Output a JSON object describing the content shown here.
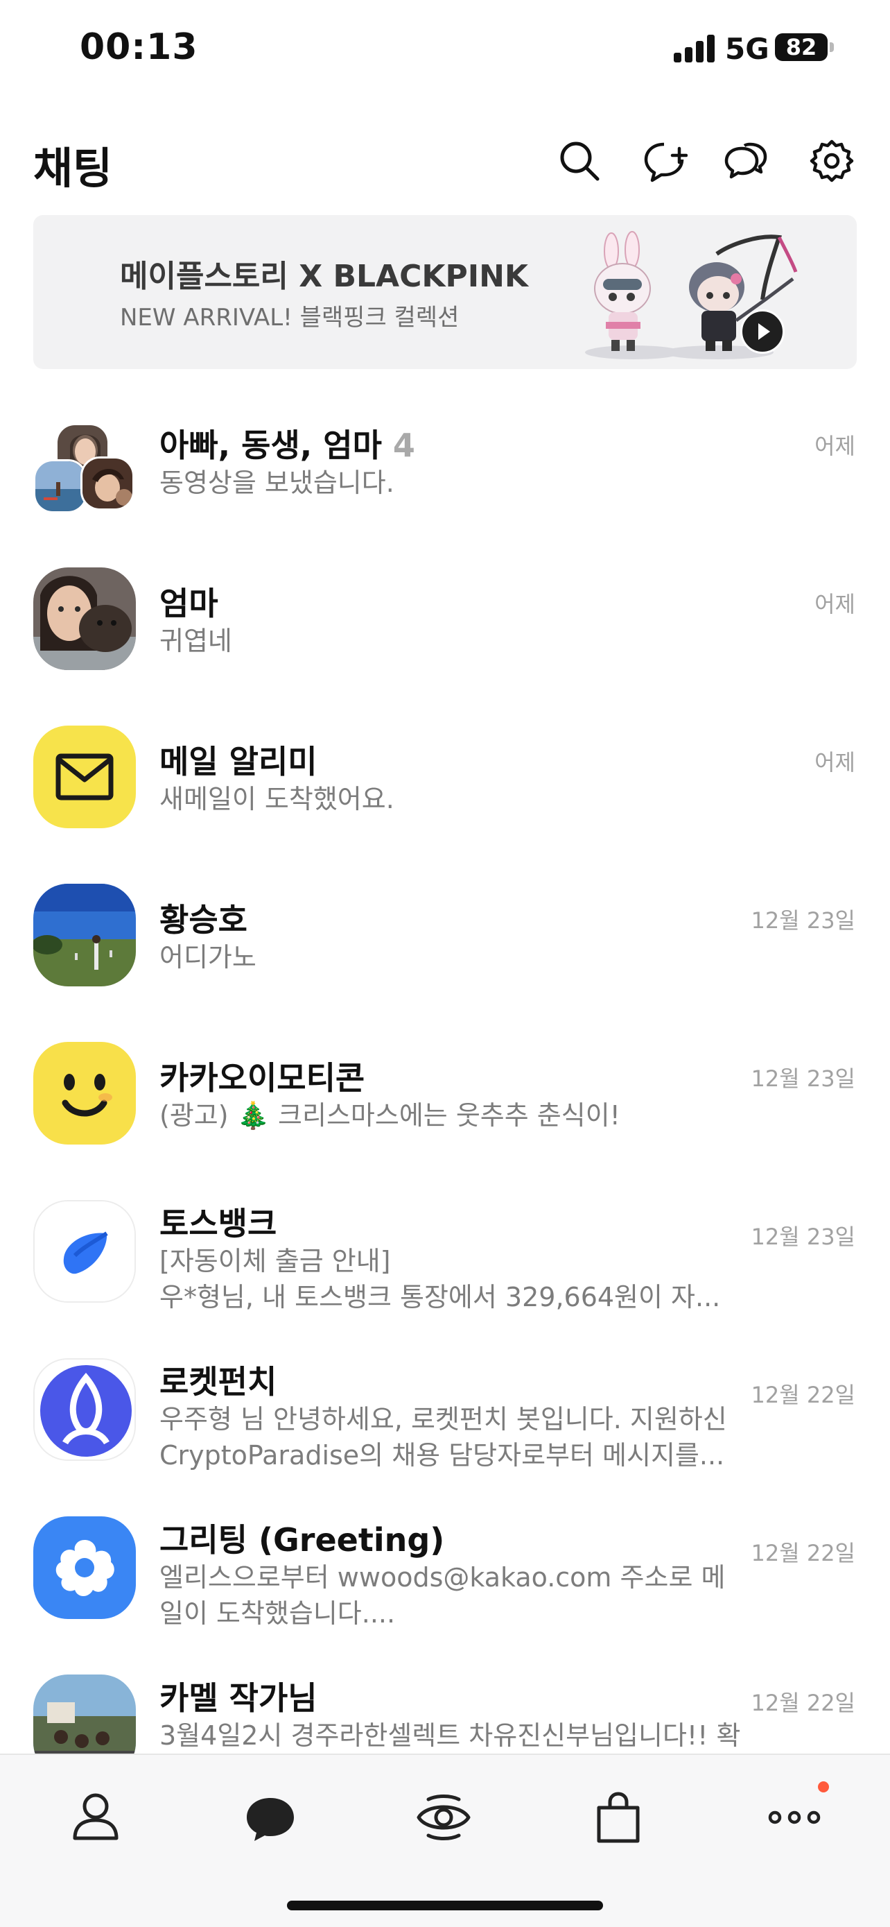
{
  "status_bar": {
    "time": "00:13",
    "network": "5G",
    "battery": "82"
  },
  "header": {
    "title": "채팅"
  },
  "banner": {
    "title": "메이플스토리 X BLACKPINK",
    "subtitle": "NEW ARRIVAL! 블랙핑크 컬렉션"
  },
  "chats": [
    {
      "name": "아빠, 동생, 엄마",
      "member_count": "4",
      "preview": "동영상을 보냈습니다.",
      "time": "어제"
    },
    {
      "name": "엄마",
      "preview": "귀엽네",
      "time": "어제"
    },
    {
      "name": "메일 알리미",
      "preview": "새메일이 도착했어요.",
      "time": "어제"
    },
    {
      "name": "황승호",
      "preview": "어디가노",
      "time": "12월 23일"
    },
    {
      "name": "카카오이모티콘",
      "preview": "(광고) 🎄 크리스마스에는 웃추추 춘식이!",
      "time": "12월 23일"
    },
    {
      "name": "토스뱅크",
      "preview_line1": "[자동이체 출금 안내]",
      "preview_line2": "우*형님, 내 토스뱅크 통장에서 329,664원이 자...",
      "time": "12월 23일"
    },
    {
      "name": "로켓펀치",
      "preview_line1": "우주형 님 안녕하세요, 로켓펀치 봇입니다. 지원하신",
      "preview_line2": "CryptoParadise의 채용 담당자로부터 메시지를...",
      "time": "12월 22일"
    },
    {
      "name": "그리팅 (Greeting)",
      "preview_line1": "엘리스으로부터 wwoods@kakao.com 주소로 메",
      "preview_line2": "일이 도착했습니다....",
      "time": "12월 22일"
    },
    {
      "name": "카멜 작가님",
      "preview": "3월4일2시 경주라한셀렉트 차유진신부님입니다!! 확",
      "time": "12월 22일"
    }
  ],
  "icons": {
    "header": [
      "search-icon",
      "new-chat-icon",
      "open-chat-icon",
      "settings-icon"
    ],
    "tabs": [
      "friends-icon",
      "chats-icon",
      "openchat-icon",
      "shopping-icon",
      "more-icon"
    ]
  },
  "colors": {
    "notification_dot": "#ff5a3c",
    "mail_yellow": "#f7e34b",
    "toss_blue": "#2f74f5",
    "rocketpunch_purple": "#4a57e8",
    "greeting_blue": "#3a86f4"
  }
}
